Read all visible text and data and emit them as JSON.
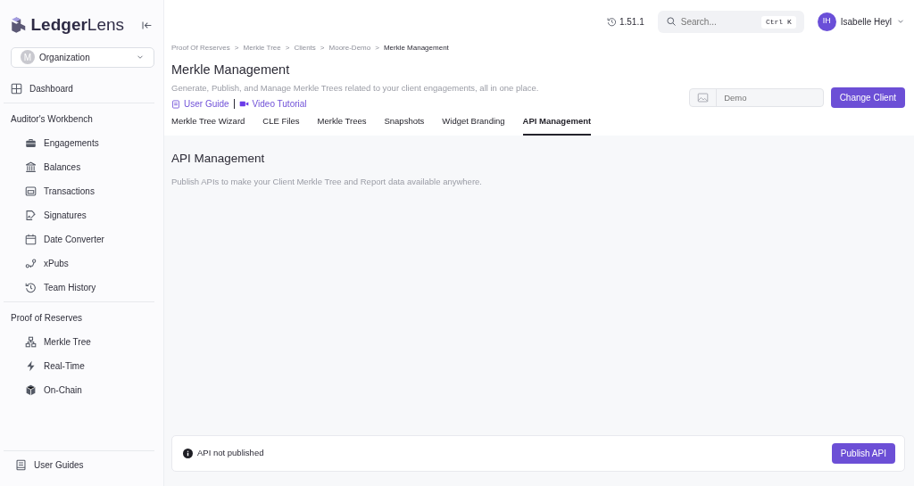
{
  "sidebar": {
    "logo": "**Ledger**Lens",
    "org_select": {
      "initial": "M",
      "label": "Organization"
    },
    "dashboard": {
      "label": "Dashboard",
      "selected": false
    },
    "sections": [
      {
        "title": "Auditor's Workbench",
        "items": [
          {
            "label": "Engagements",
            "selected": false
          },
          {
            "label": "Balances",
            "selected": false
          },
          {
            "label": "Transactions",
            "selected": false
          },
          {
            "label": "Signatures",
            "selected": false
          },
          {
            "label": "Date Converter",
            "selected": false
          },
          {
            "label": "xPubs",
            "selected": false
          },
          {
            "label": "Team History",
            "selected": false
          }
        ]
      },
      {
        "title": "Proof of Reserves",
        "items": [
          {
            "label": "Merkle Tree",
            "selected": false
          },
          {
            "label": "Real-Time",
            "selected": false
          },
          {
            "label": "On-Chain",
            "selected": false
          }
        ]
      }
    ],
    "footer": {
      "label": "User Guides"
    }
  },
  "topbar": {
    "version": "1.51.1",
    "search": {
      "placeholder": "Search...",
      "shortcut": "Ctrl K"
    },
    "user": {
      "initials": "IH",
      "name": "Isabelle Heyl"
    }
  },
  "breadcrumbs": [
    {
      "label": "Proof Of Reserves",
      "separator": ">"
    },
    {
      "label": "Merkle Tree",
      "separator": ">"
    },
    {
      "label": "Clients",
      "separator": ">"
    },
    {
      "label": "Moore-Demo",
      "separator": ">"
    },
    {
      "label": "Merkle Management"
    }
  ],
  "page": {
    "title": "Merkle Management",
    "subtitle": "Generate, Publish, and Manage Merkle Trees related to your client engagements, all in one place.",
    "links": [
      "User Guide",
      "Video Tutorial"
    ],
    "client_field": {
      "placeholder": "Demo"
    },
    "change_client": "Change Client"
  },
  "tabs": [
    {
      "label": "Merkle Tree Wizard",
      "selected": false
    },
    {
      "label": "CLE Files",
      "selected": false
    },
    {
      "label": "Merkle Trees",
      "selected": false
    },
    {
      "label": "Snapshots",
      "selected": false
    },
    {
      "label": "Widget Branding",
      "selected": false
    },
    {
      "label": "API Management",
      "selected": true
    }
  ],
  "section": {
    "title": "API Management",
    "description": "Publish APIs to make your Client Merkle Tree and Report data available anywhere."
  },
  "status_card": {
    "message": "API not published",
    "button": "Publish API"
  }
}
